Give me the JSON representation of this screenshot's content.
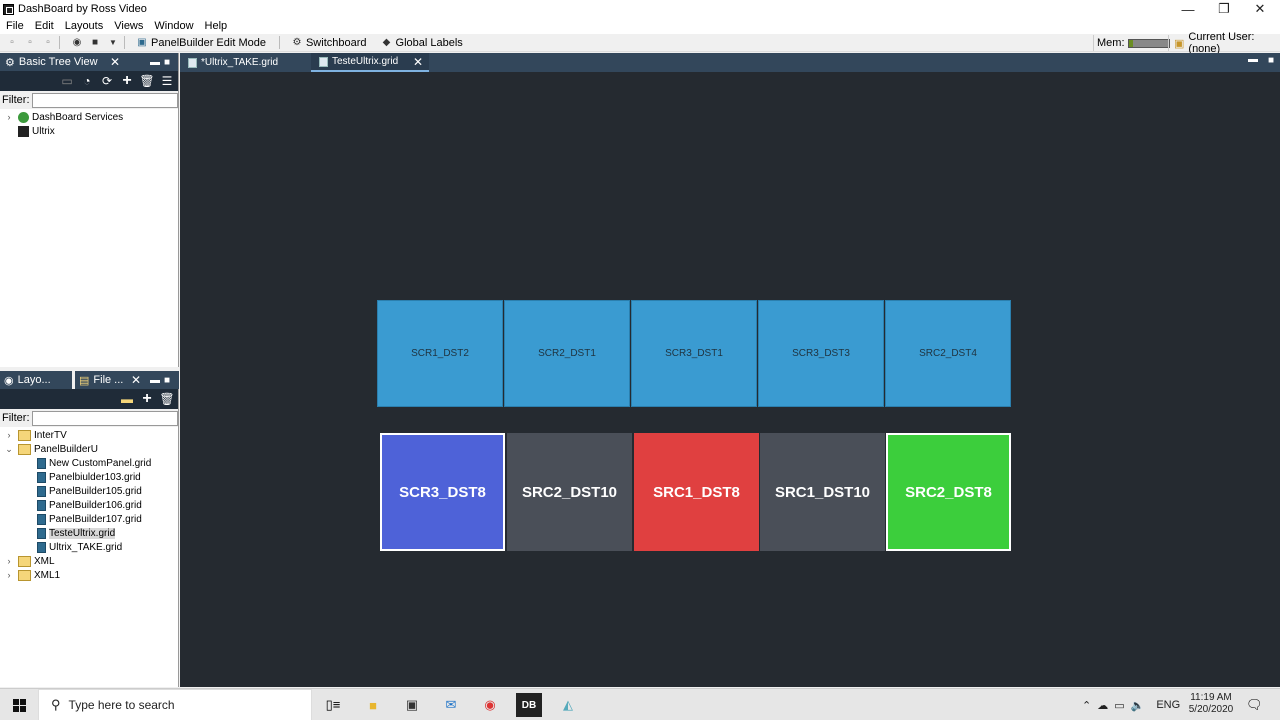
{
  "window": {
    "title": "DashBoard by Ross Video",
    "min": "—",
    "max": "❐",
    "close": "✕"
  },
  "menu": [
    "File",
    "Edit",
    "Layouts",
    "Views",
    "Window",
    "Help"
  ],
  "toolbar": {
    "panelbuilder": "PanelBuilder Edit Mode",
    "switchboard": "Switchboard",
    "global_labels": "Global Labels",
    "mem_label": "Mem:",
    "current_user": "Current User: (none)"
  },
  "tree_panel": {
    "title": "Basic Tree View",
    "filter_label": "Filter:",
    "items": [
      "DashBoard Services",
      "Ultrix"
    ]
  },
  "file_panel": {
    "tab_layouts": "Layo...",
    "tab_files": "File ...",
    "filter_label": "Filter:",
    "items": {
      "intertv": "InterTV",
      "panelbuilderu": "PanelBuilderU",
      "f1": "New CustomPanel.grid",
      "f2": "Panelbiulder103.grid",
      "f3": "PanelBuilder105.grid",
      "f4": "PanelBuilder106.grid",
      "f5": "PanelBuilder107.grid",
      "f6": "TesteUltrix.grid",
      "f7": "Ultrix_TAKE.grid",
      "xml": "XML",
      "xml1": "XML1"
    }
  },
  "editor_tabs": {
    "tab1": "*Ultrix_TAKE.grid",
    "tab2": "TesteUltrix.grid"
  },
  "sources": [
    "SCR1_DST2",
    "SCR2_DST1",
    "SCR3_DST1",
    "SCR3_DST3",
    "SRC2_DST4"
  ],
  "destinations": [
    "SCR3_DST8",
    "SRC2_DST10",
    "SRC1_DST8",
    "SRC1_DST10",
    "SRC2_DST8"
  ],
  "colors": {
    "source_blue": "#3a9bd1",
    "dst_blue": "#4e62d8",
    "dst_gray": "#4a4f58",
    "dst_red": "#e04040",
    "dst_green": "#3cce3c"
  },
  "taskbar": {
    "search_placeholder": "Type here to search",
    "lang": "ENG",
    "time": "11:19 AM",
    "date": "5/20/2020"
  }
}
